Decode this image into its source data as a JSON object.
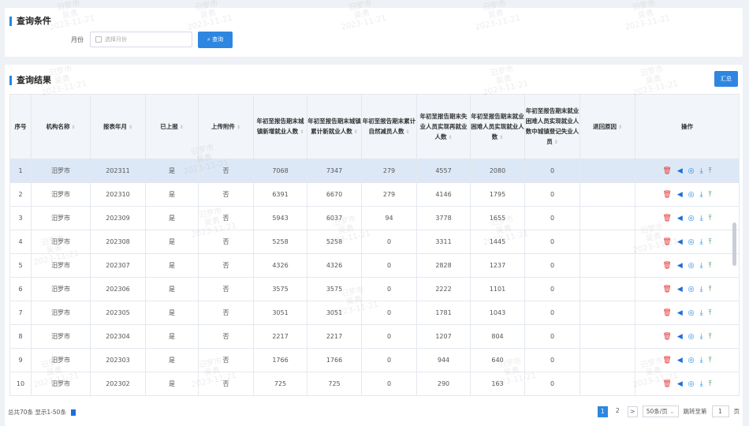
{
  "query_panel": {
    "title": "查询条件",
    "month_label": "月份",
    "month_placeholder": "选择月份",
    "search_button": "查询"
  },
  "results_panel": {
    "title": "查询结果",
    "summary_button": "汇总",
    "columns": [
      "序号",
      "机构名称",
      "报表年月",
      "已上报",
      "上传附件",
      "年初至报告期末城镇新增就业人数",
      "年初至报告期末城镇累计新就业人数",
      "年初至报告期末累计自然减员人数",
      "年初至报告期末失业人员实现再就业人数",
      "年初至报告期末就业困难人员实现就业人数",
      "年初至报告期末就业困难人员实现就业人数中城镇登记失业人员",
      "退回原因",
      "操作"
    ],
    "rows": [
      [
        "1",
        "汨罗市",
        "202311",
        "是",
        "否",
        "7068",
        "7347",
        "279",
        "4557",
        "2080",
        "0",
        ""
      ],
      [
        "2",
        "汨罗市",
        "202310",
        "是",
        "否",
        "6391",
        "6670",
        "279",
        "4146",
        "1795",
        "0",
        ""
      ],
      [
        "3",
        "汨罗市",
        "202309",
        "是",
        "否",
        "5943",
        "6037",
        "94",
        "3778",
        "1655",
        "0",
        ""
      ],
      [
        "4",
        "汨罗市",
        "202308",
        "是",
        "否",
        "5258",
        "5258",
        "0",
        "3311",
        "1445",
        "0",
        ""
      ],
      [
        "5",
        "汨罗市",
        "202307",
        "是",
        "否",
        "4326",
        "4326",
        "0",
        "2828",
        "1237",
        "0",
        ""
      ],
      [
        "6",
        "汨罗市",
        "202306",
        "是",
        "否",
        "3575",
        "3575",
        "0",
        "2222",
        "1101",
        "0",
        ""
      ],
      [
        "7",
        "汨罗市",
        "202305",
        "是",
        "否",
        "3051",
        "3051",
        "0",
        "1781",
        "1043",
        "0",
        ""
      ],
      [
        "8",
        "汨罗市",
        "202304",
        "是",
        "否",
        "2217",
        "2217",
        "0",
        "1207",
        "804",
        "0",
        ""
      ],
      [
        "9",
        "汨罗市",
        "202303",
        "是",
        "否",
        "1766",
        "1766",
        "0",
        "944",
        "640",
        "0",
        ""
      ],
      [
        "10",
        "汨罗市",
        "202302",
        "是",
        "否",
        "725",
        "725",
        "0",
        "290",
        "163",
        "0",
        ""
      ]
    ],
    "sortable": [
      false,
      true,
      true,
      true,
      true,
      true,
      true,
      true,
      true,
      true,
      true,
      true,
      false
    ],
    "row_actions": [
      "delete-icon",
      "send-icon",
      "view-icon",
      "download-icon",
      "upload-icon"
    ],
    "selected_row": 0
  },
  "footer": {
    "summary": "总共70条 显示1-50条"
  },
  "pagination": {
    "pages": [
      "1",
      "2"
    ],
    "current": "1",
    "next": ">",
    "page_size": "50条/页",
    "jump_label": "跳转至第",
    "jump_value": "1",
    "jump_suffix": "页"
  },
  "watermark": {
    "lines": [
      "汨罗市",
      "吴勇",
      "2023-11-21"
    ]
  },
  "colors": {
    "accent": "#2e86e0",
    "delete": "#e53935",
    "upload": "#2e9e44",
    "selected_row": "#dde8f6"
  }
}
